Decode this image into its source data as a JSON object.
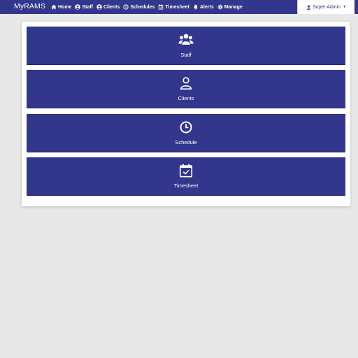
{
  "app": {
    "brand": "MyRAMS"
  },
  "nav": {
    "items": [
      {
        "label": "Home",
        "icon": "home-icon"
      },
      {
        "label": "Staff",
        "icon": "user-circle-icon"
      },
      {
        "label": "Clients",
        "icon": "user-circle-icon"
      },
      {
        "label": "Schedules",
        "icon": "clock-icon"
      },
      {
        "label": "Timesheet",
        "icon": "calendar-check-icon"
      },
      {
        "label": "Alerts",
        "icon": "bell-icon"
      },
      {
        "label": "Manage",
        "icon": "gear-icon"
      }
    ],
    "user": {
      "label": "Super Admin",
      "icon": "user-icon"
    }
  },
  "dashboard": {
    "tiles": [
      {
        "label": "Staff",
        "icon": "users-icon"
      },
      {
        "label": "Clients",
        "icon": "user-outline-icon"
      },
      {
        "label": "Schedule",
        "icon": "clock-icon"
      },
      {
        "label": "Timesheet",
        "icon": "calendar-check-icon"
      }
    ]
  },
  "colors": {
    "primary": "#32368c",
    "background": "#e8e8e8",
    "panel": "#ffffff",
    "text_on_primary": "#ffffff"
  }
}
